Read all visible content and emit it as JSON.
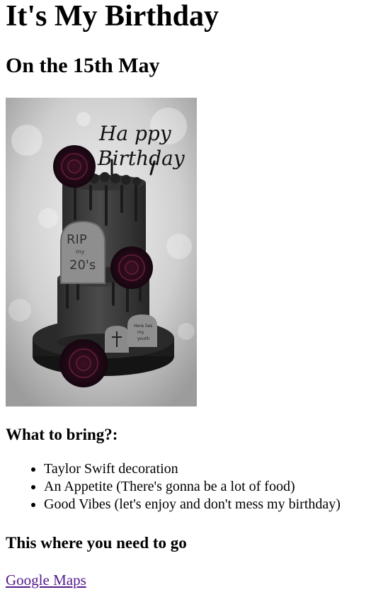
{
  "heading": "It's My Birthday",
  "date_heading": "On the 15th May",
  "image": {
    "alt": "Black birthday cake",
    "topper_line1": "Ha ppy",
    "topper_line2": "Birthday",
    "tombstone_text": "RIP my 20's",
    "small_stone_text": "Here lies my youth"
  },
  "bring": {
    "heading": "What to bring?:",
    "items": [
      "Taylor Swift decoration",
      "An Appetite (There's gonna be a lot of food)",
      "Good Vibes (let's enjoy and don't mess my birthday)"
    ]
  },
  "directions": {
    "heading": "This where you need to go",
    "link_label": "Google Maps"
  }
}
